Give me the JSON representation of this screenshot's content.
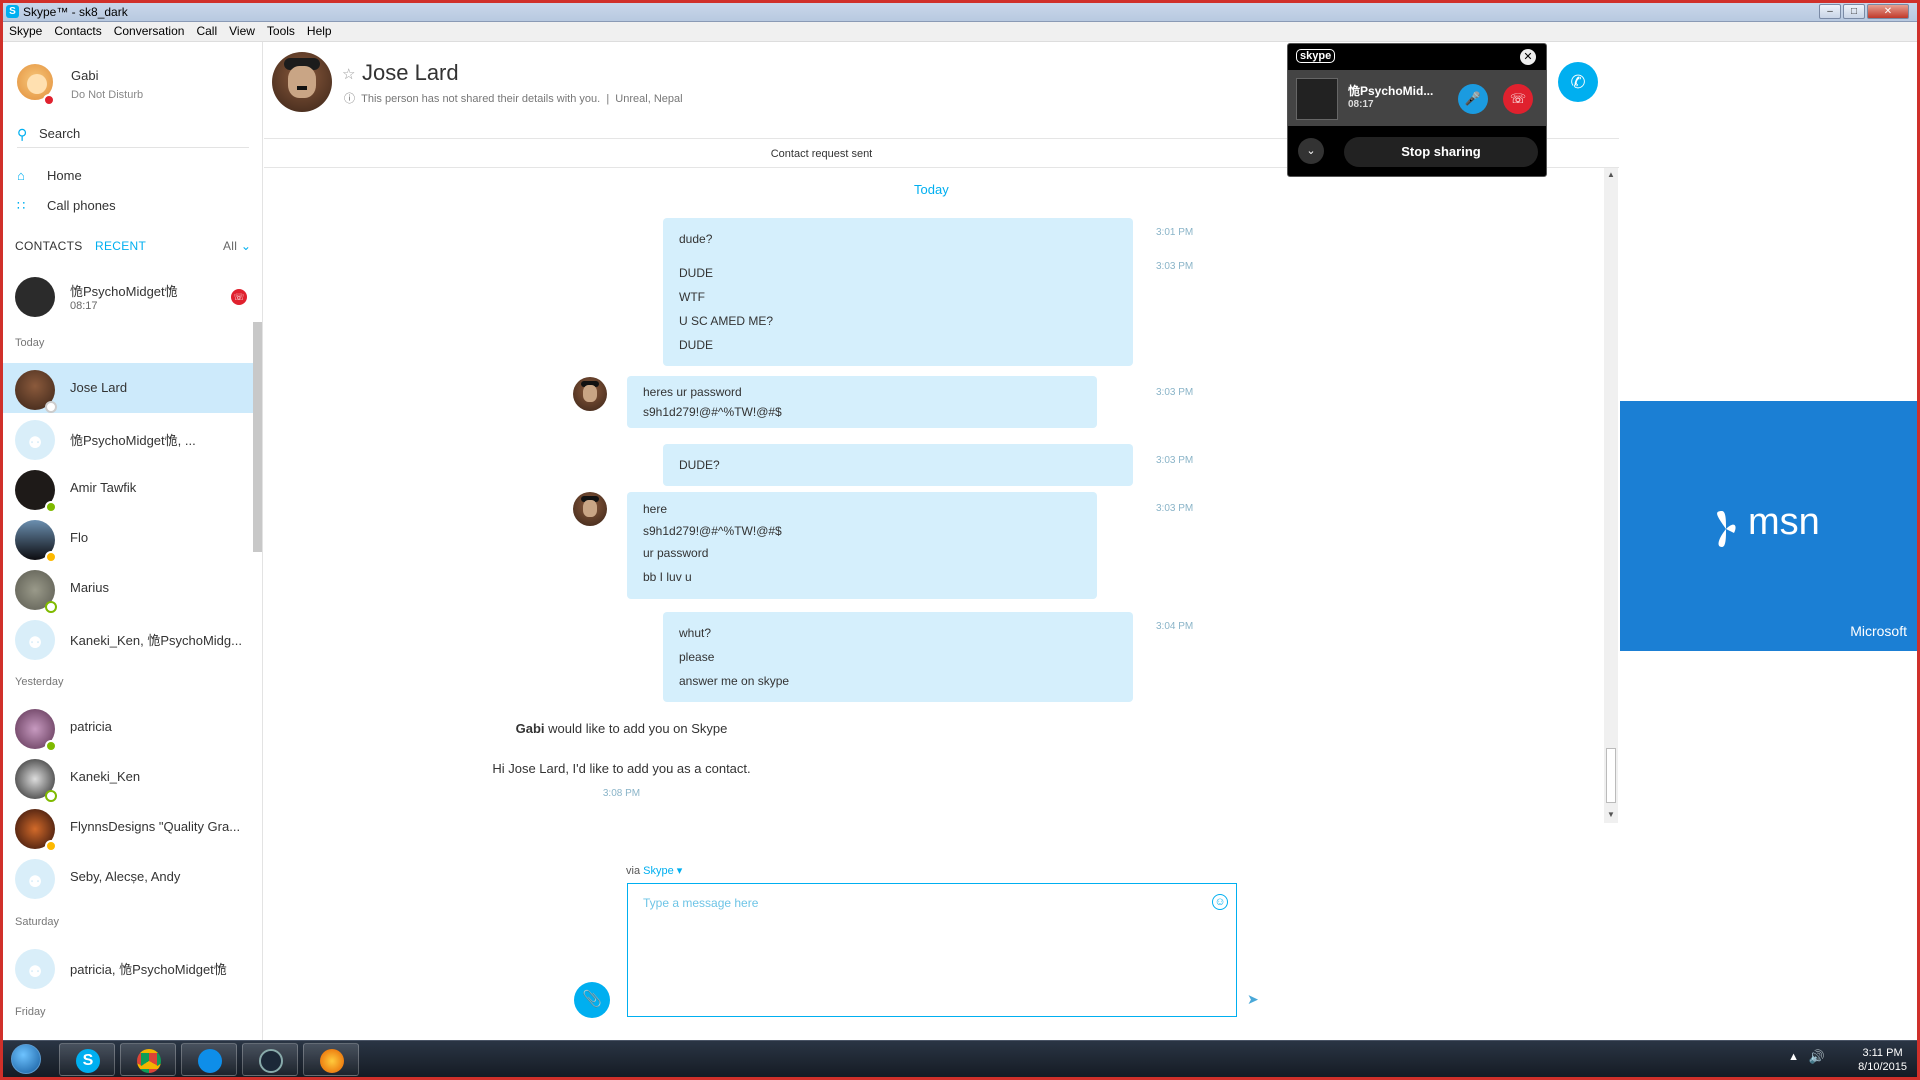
{
  "window": {
    "title": "Skype™ - sk8_dark"
  },
  "menu": [
    "Skype",
    "Contacts",
    "Conversation",
    "Call",
    "View",
    "Tools",
    "Help"
  ],
  "profile": {
    "name": "Gabi",
    "status": "Do Not Disturb"
  },
  "search": {
    "label": "Search"
  },
  "nav": {
    "home": "Home",
    "call_phones": "Call phones"
  },
  "tabs": {
    "contacts": "CONTACTS",
    "recent": "RECENT",
    "filter": "All"
  },
  "active_call": {
    "name": "恑PsychoMidget恑",
    "time": "08:17"
  },
  "sections": {
    "today": "Today",
    "yesterday": "Yesterday",
    "saturday": "Saturday",
    "friday": "Friday"
  },
  "contacts_today": [
    {
      "name": "Jose Lard",
      "status": "unknown",
      "avatar": "portrait"
    },
    {
      "name": "恑PsychoMidget恑, ...",
      "status": "none",
      "avatar": "group"
    },
    {
      "name": "Amir Tawfik",
      "status": "online",
      "avatar": "dark"
    },
    {
      "name": "Flo",
      "status": "away",
      "avatar": "photo"
    },
    {
      "name": "Marius",
      "status": "offline",
      "avatar": "photo"
    },
    {
      "name": "Kaneki_Ken, 恑PsychoMidg...",
      "status": "none",
      "avatar": "group"
    }
  ],
  "contacts_yesterday": [
    {
      "name": "patricia",
      "status": "online",
      "avatar": "photo"
    },
    {
      "name": "Kaneki_Ken",
      "status": "offline",
      "avatar": "photo"
    },
    {
      "name": "FlynnsDesigns \"Quality Gra...",
      "status": "away",
      "avatar": "photo"
    },
    {
      "name": "Seby, Alecșe, Andy",
      "status": "none",
      "avatar": "group"
    }
  ],
  "contacts_saturday": [
    {
      "name": "patricia, 恑PsychoMidget恑",
      "status": "none",
      "avatar": "group"
    }
  ],
  "conversation": {
    "name": "Jose Lard",
    "info": "This person has not shared their details with you.",
    "location": "Unreal, Nepal",
    "request_banner": "Contact request sent",
    "date_divider": "Today"
  },
  "messages": [
    {
      "side": "out",
      "lines": [
        "dude?"
      ],
      "time": "3:01 PM"
    },
    {
      "side": "out",
      "lines": [
        "DUDE",
        "WTF",
        "U SC AMED ME?",
        "DUDE"
      ],
      "time": "3:03 PM"
    },
    {
      "side": "in",
      "lines": [
        "heres ur password",
        "s9h1d279!@#^%TW!@#$"
      ],
      "time": "3:03 PM"
    },
    {
      "side": "out",
      "lines": [
        "DUDE?"
      ],
      "time": "3:03 PM"
    },
    {
      "side": "in",
      "lines": [
        "here",
        "s9h1d279!@#^%TW!@#$",
        "ur password",
        "bb I luv u"
      ],
      "time": "3:03 PM"
    },
    {
      "side": "out",
      "lines": [
        "whut?",
        "please",
        "answer me on skype"
      ],
      "time": "3:04 PM"
    }
  ],
  "system": {
    "add_name": "Gabi",
    "add_text": " would like to add you on Skype",
    "add_message": "Hi Jose Lard, I'd like to add you as a contact.",
    "add_time": "3:08 PM"
  },
  "composer": {
    "via": "via",
    "via_service": "Skype",
    "placeholder": "Type a message here"
  },
  "call_window": {
    "brand": "skype",
    "name": "恑PsychoMid...",
    "time": "08:17",
    "stop_label": "Stop sharing"
  },
  "ad": {
    "brand": "msn",
    "sponsor": "Microsoft"
  },
  "taskbar": {
    "time": "3:11 PM",
    "date": "8/10/2015"
  },
  "colors": {
    "accent": "#00aff0",
    "bubble": "#d5effc",
    "selected": "#cdeafb",
    "dnd": "#e0212e",
    "online": "#7fba00",
    "away": "#fdb900",
    "ad_bg": "#1b7fd4"
  }
}
